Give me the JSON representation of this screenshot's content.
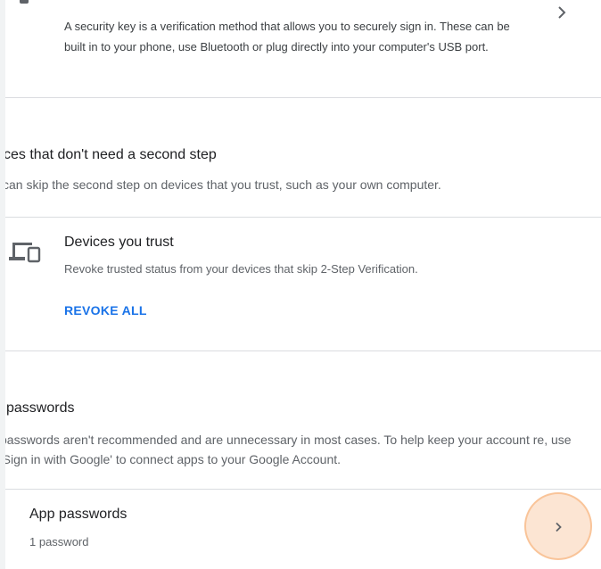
{
  "security_key": {
    "description": "A security key is a verification method that allows you to securely sign in. These can be built in to your phone, use Bluetooth or plug directly into your computer's USB port."
  },
  "skip_section": {
    "title": "ces that don't need a second step",
    "description": "can skip the second step on devices that you trust, such as your own computer."
  },
  "trusted_devices": {
    "title": "Devices you trust",
    "description": "Revoke trusted status from your devices that skip 2-Step Verification.",
    "revoke_label": "REVOKE ALL"
  },
  "app_passwords_section": {
    "title": "passwords",
    "description": "passwords aren't recommended and are unnecessary in most cases. To help keep your account re, use 'Sign in with Google' to connect apps to your Google Account."
  },
  "app_passwords_row": {
    "title": "App passwords",
    "count": "1 password"
  },
  "colors": {
    "accent": "#1a73e8",
    "divider": "#dadce0",
    "click_highlight": "#f7b580"
  }
}
